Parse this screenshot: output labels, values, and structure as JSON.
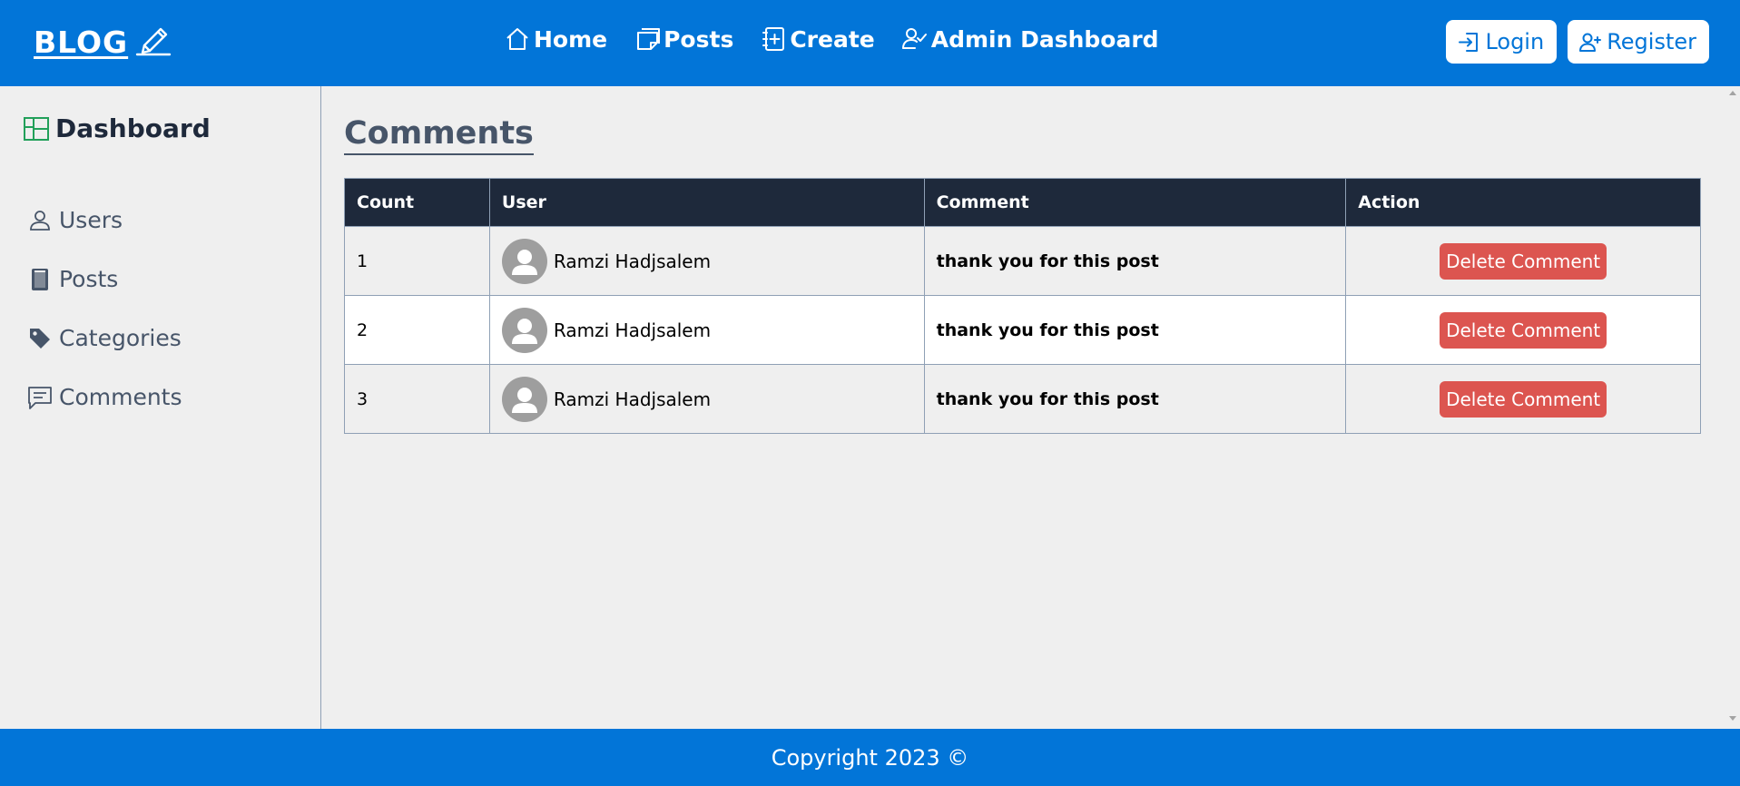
{
  "header": {
    "logo_text": "BLOG",
    "nav": [
      {
        "label": "Home",
        "icon": "home-icon"
      },
      {
        "label": "Posts",
        "icon": "posts-icon"
      },
      {
        "label": "Create",
        "icon": "create-icon"
      },
      {
        "label": "Admin Dashboard",
        "icon": "admin-icon"
      }
    ],
    "login_label": "Login",
    "register_label": "Register"
  },
  "sidebar": {
    "title": "Dashboard",
    "items": [
      {
        "label": "Users",
        "icon": "user-icon"
      },
      {
        "label": "Posts",
        "icon": "posts-icon"
      },
      {
        "label": "Categories",
        "icon": "tag-icon"
      },
      {
        "label": "Comments",
        "icon": "comment-icon"
      }
    ]
  },
  "main": {
    "title": "Comments",
    "columns": [
      "Count",
      "User",
      "Comment",
      "Action"
    ],
    "rows": [
      {
        "count": "1",
        "user": "Ramzi Hadjsalem",
        "comment": "thank you for this post",
        "action": "Delete Comment"
      },
      {
        "count": "2",
        "user": "Ramzi Hadjsalem",
        "comment": "thank you for this post",
        "action": "Delete Comment"
      },
      {
        "count": "3",
        "user": "Ramzi Hadjsalem",
        "comment": "thank you for this post",
        "action": "Delete Comment"
      }
    ]
  },
  "footer": {
    "text": "Copyright 2023 ©"
  },
  "colors": {
    "primary": "#0275d8",
    "table_header": "#1e293b",
    "delete": "#dc5550",
    "sidebar_text": "#475569",
    "dashboard_icon": "#22a05a"
  }
}
